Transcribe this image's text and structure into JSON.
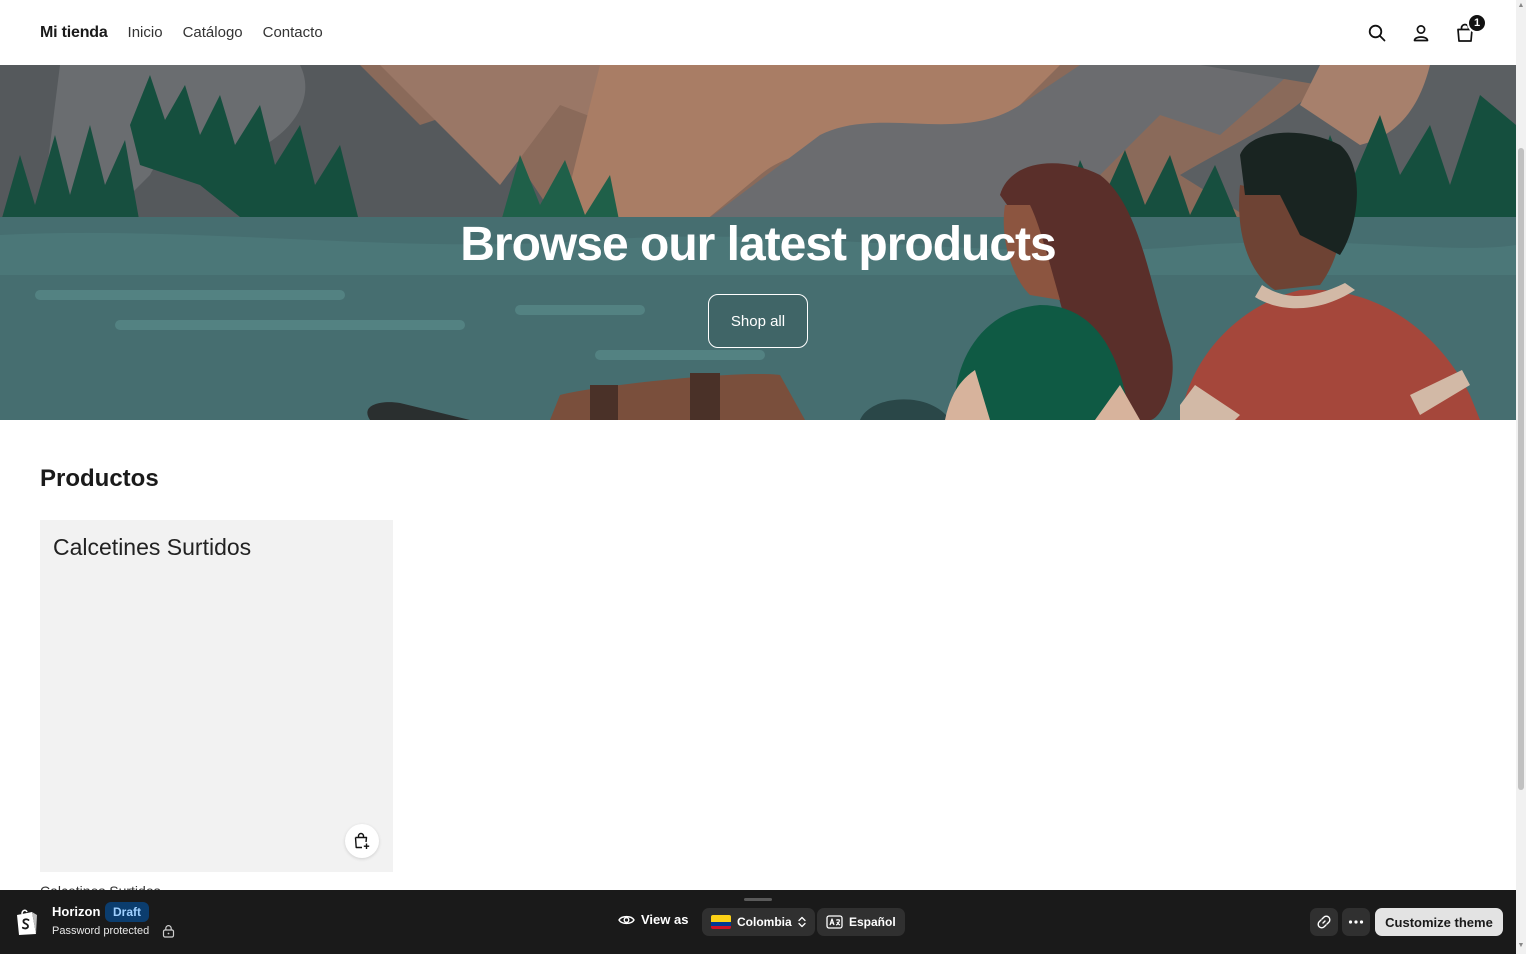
{
  "header": {
    "logo": "Mi tienda",
    "nav": [
      "Inicio",
      "Catálogo",
      "Contacto"
    ],
    "cart_count": "1",
    "icons": [
      "search-icon",
      "account-icon",
      "cart-icon"
    ]
  },
  "hero": {
    "title": "Browse our latest products",
    "button_label": "Shop all"
  },
  "products": {
    "section_title": "Productos",
    "items": [
      {
        "card_title": "Calcetines Surtidos",
        "name": "Calcetines Surtidos"
      }
    ]
  },
  "preview_bar": {
    "theme_name": "Horizon",
    "status_badge": "Draft",
    "password_text": "Password protected",
    "view_as_label": "View as",
    "country": "Colombia",
    "language": "Español",
    "customize_label": "Customize theme"
  },
  "colors": {
    "accent_dark": "#1a1a1a",
    "draft_badge_bg": "#0b3d6e",
    "draft_badge_text": "#9fd0ff"
  }
}
